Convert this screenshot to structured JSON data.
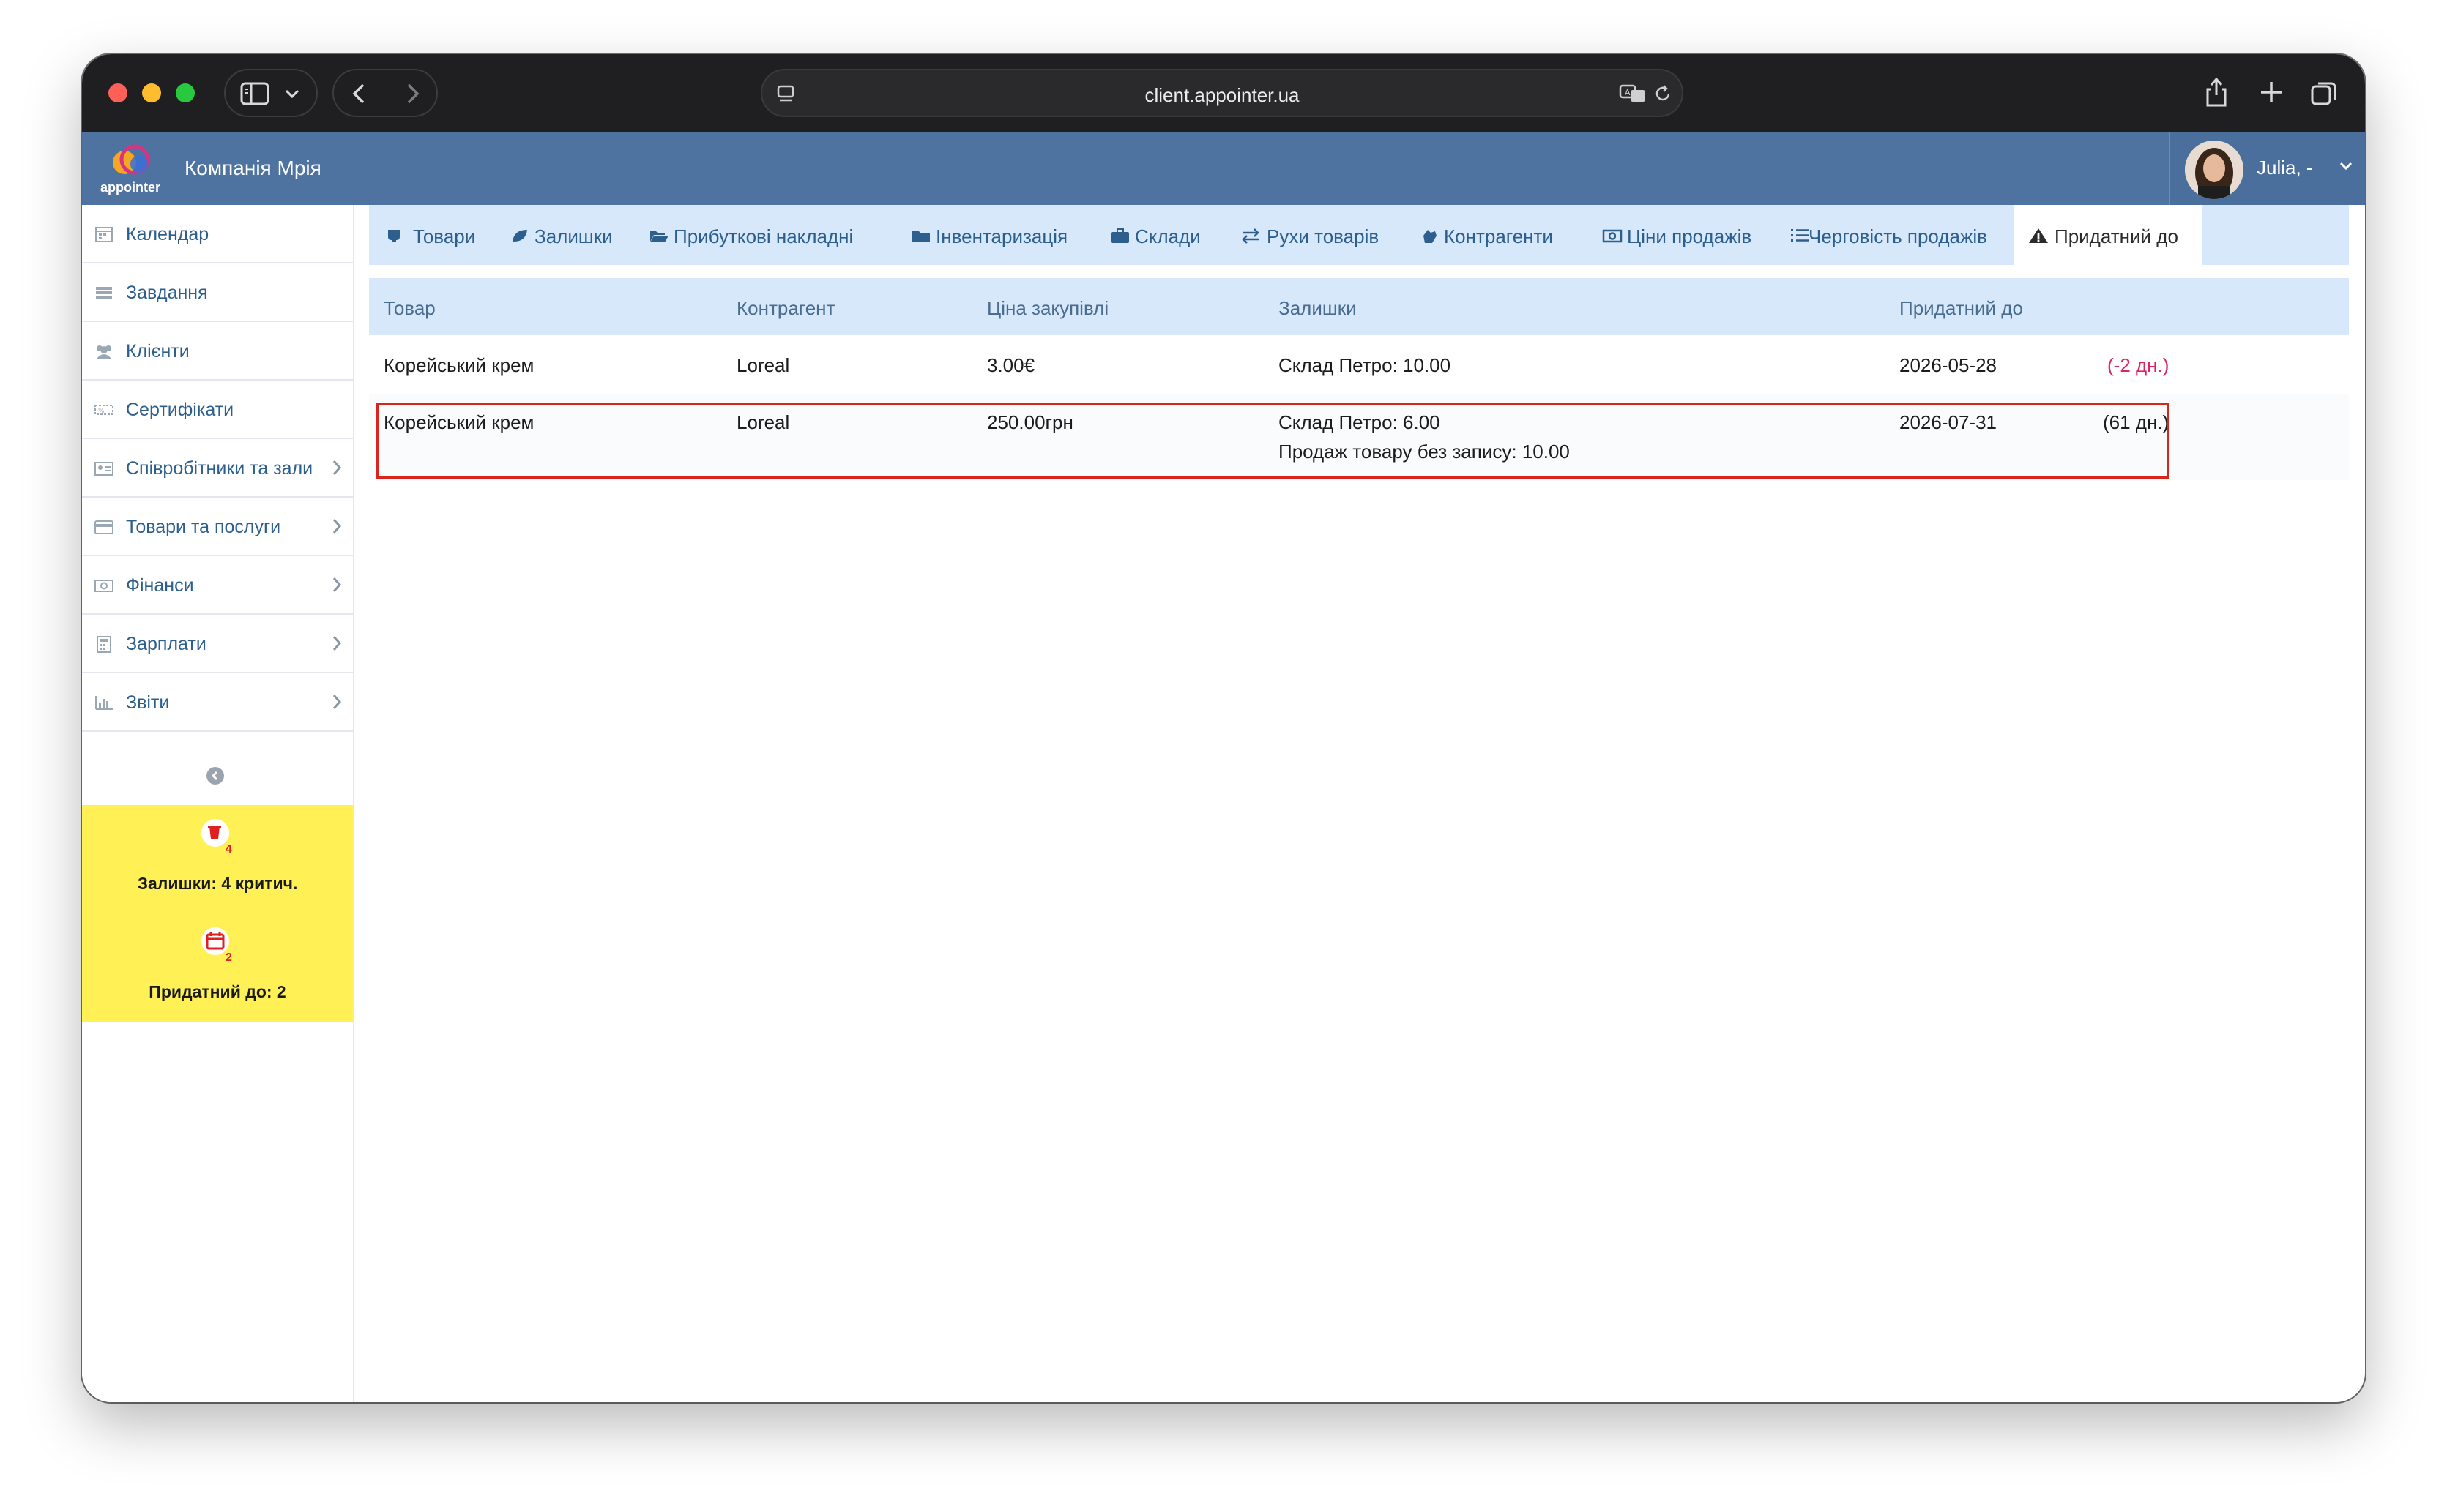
{
  "browser": {
    "url": "client.appointer.ua"
  },
  "header": {
    "logo_text": "appointer",
    "company": "Компанія Мрія",
    "user_name": "Julia, -"
  },
  "sidebar": {
    "items": [
      {
        "label": "Календар",
        "icon": "calendar-icon",
        "chevron": false
      },
      {
        "label": "Завдання",
        "icon": "tasks-icon",
        "chevron": false
      },
      {
        "label": "Клієнти",
        "icon": "users-icon",
        "chevron": false
      },
      {
        "label": "Сертифікати",
        "icon": "certificate-icon",
        "chevron": false
      },
      {
        "label": "Співробітники та зали",
        "icon": "id-card-icon",
        "chevron": true
      },
      {
        "label": "Товари та послуги",
        "icon": "card-icon",
        "chevron": true
      },
      {
        "label": "Фінанси",
        "icon": "money-icon",
        "chevron": true
      },
      {
        "label": "Зарплати",
        "icon": "calculator-icon",
        "chevron": true
      },
      {
        "label": "Звіти",
        "icon": "bar-chart-icon",
        "chevron": true
      }
    ],
    "alerts": {
      "stock_badge": "4",
      "stock_text": "Залишки: 4 критич.",
      "expiry_badge": "2",
      "expiry_text": "Придатний до: 2"
    }
  },
  "tabs": [
    {
      "label": "Товари",
      "icon": "product-icon"
    },
    {
      "label": "Залишки",
      "icon": "leaf-icon"
    },
    {
      "label": "Прибуткові накладні",
      "icon": "folder-open-icon"
    },
    {
      "label": "Інвентаризація",
      "icon": "folder-icon"
    },
    {
      "label": "Склади",
      "icon": "briefcase-icon"
    },
    {
      "label": "Рухи товарів",
      "icon": "exchange-icon"
    },
    {
      "label": "Контрагенти",
      "icon": "handshake-icon"
    },
    {
      "label": "Ціни продажів",
      "icon": "money-icon"
    },
    {
      "label": "Черговість продажів",
      "icon": "list-icon"
    },
    {
      "label": "Придатний до",
      "icon": "warning-icon",
      "active": true
    }
  ],
  "table": {
    "columns": [
      "Товар",
      "Контрагент",
      "Ціна закупівлі",
      "Залишки",
      "Придатний до"
    ],
    "rows": [
      {
        "product": "Корейський крем",
        "supplier": "Loreal",
        "price": "3.00€",
        "stock_line1": "Склад Петро: 10.00",
        "stock_line2": "",
        "expiry_date": "2026-05-28",
        "expiry_days": "(-2 дн.)",
        "expired": true
      },
      {
        "product": "Корейський крем",
        "supplier": "Loreal",
        "price": "250.00грн",
        "stock_line1": "Склад Петро: 6.00",
        "stock_line2": "Продаж товару без запису: 10.00",
        "expiry_date": "2026-07-31",
        "expiry_days": "(61 дн.)",
        "expired": false
      }
    ]
  },
  "colors": {
    "header_bg": "#4e73a0",
    "tab_bg": "#d7e8fb",
    "link": "#2d5f8e",
    "alert_bg": "#fff056",
    "negative": "#e0245e",
    "highlight_border": "#d9261c"
  }
}
